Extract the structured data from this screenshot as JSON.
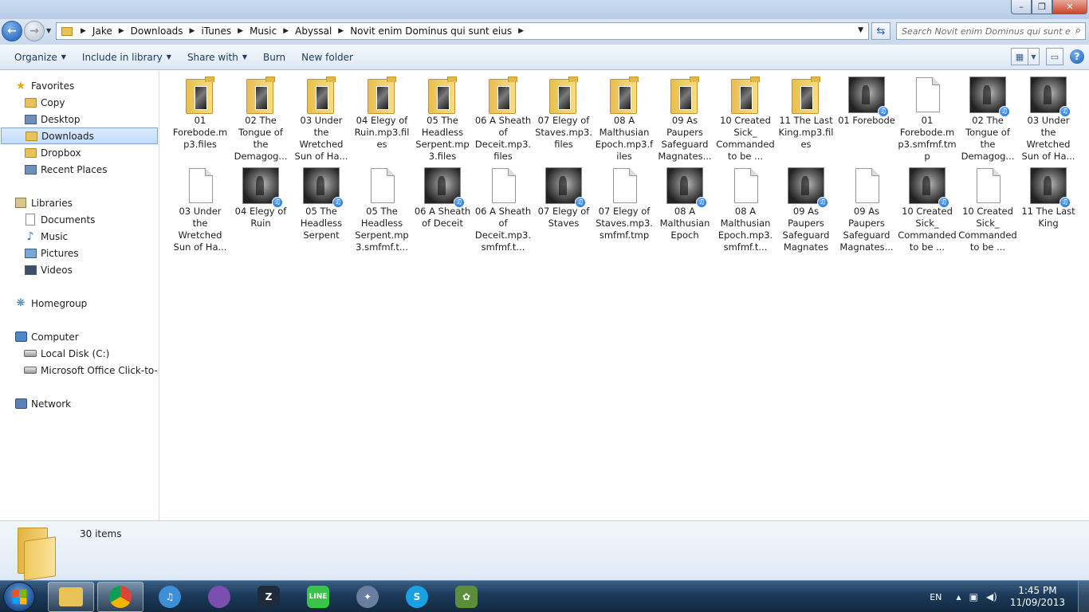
{
  "window": {
    "min_label": "–",
    "max_label": "❐",
    "close_label": "✕"
  },
  "address": {
    "breadcrumbs": [
      "Jake",
      "Downloads",
      "iTunes",
      "Music",
      "Abyssal",
      "Novit enim Dominus qui sunt eius"
    ]
  },
  "search": {
    "placeholder": "Search Novit enim Dominus qui sunt e..."
  },
  "toolbar": {
    "organize": "Organize",
    "include_in_library": "Include in library",
    "share_with": "Share with",
    "burn": "Burn",
    "new_folder": "New folder",
    "help": "?"
  },
  "sidebar": {
    "favorites": "Favorites",
    "fav_items": [
      "Copy",
      "Desktop",
      "Downloads",
      "Dropbox",
      "Recent Places"
    ],
    "libraries": "Libraries",
    "lib_items": [
      "Documents",
      "Music",
      "Pictures",
      "Videos"
    ],
    "homegroup": "Homegroup",
    "computer": "Computer",
    "comp_items": [
      "Local Disk (C:)",
      "Microsoft Office Click-to-Run"
    ],
    "network": "Network"
  },
  "files": [
    {
      "name": "01 Forebode.mp3.files",
      "type": "folder"
    },
    {
      "name": "02 The Tongue of the Demagog...",
      "type": "folder"
    },
    {
      "name": "03 Under the Wretched Sun of Ha...",
      "type": "folder"
    },
    {
      "name": "04 Elegy of Ruin.mp3.files",
      "type": "folder"
    },
    {
      "name": "05 The Headless Serpent.mp3.files",
      "type": "folder"
    },
    {
      "name": "06 A Sheath of Deceit.mp3.files",
      "type": "folder"
    },
    {
      "name": "07 Elegy of Staves.mp3.files",
      "type": "folder"
    },
    {
      "name": "08 A Malthusian Epoch.mp3.files",
      "type": "folder"
    },
    {
      "name": "09 As Paupers Safeguard Magnates...",
      "type": "folder"
    },
    {
      "name": "10 Created Sick_ Commanded to be ...",
      "type": "folder"
    },
    {
      "name": "11 The Last King.mp3.files",
      "type": "folder"
    },
    {
      "name": "01 Forebode",
      "type": "audio"
    },
    {
      "name": "01 Forebode.mp3.smfmf.tmp",
      "type": "file"
    },
    {
      "name": "02 The Tongue of the Demagog...",
      "type": "audio"
    },
    {
      "name": "03 Under the Wretched Sun of Ha...",
      "type": "audio"
    },
    {
      "name": "03 Under the Wretched Sun of Ha...",
      "type": "file"
    },
    {
      "name": "04 Elegy of Ruin",
      "type": "audio"
    },
    {
      "name": "05 The Headless Serpent",
      "type": "audio"
    },
    {
      "name": "05 The Headless Serpent.mp3.smfmf.t...",
      "type": "file"
    },
    {
      "name": "06 A Sheath of Deceit",
      "type": "audio"
    },
    {
      "name": "06 A Sheath of Deceit.mp3.smfmf.t...",
      "type": "file"
    },
    {
      "name": "07 Elegy of Staves",
      "type": "audio"
    },
    {
      "name": "07 Elegy of Staves.mp3.smfmf.tmp",
      "type": "file"
    },
    {
      "name": "08 A Malthusian Epoch",
      "type": "audio"
    },
    {
      "name": "08 A Malthusian Epoch.mp3.smfmf.t...",
      "type": "file"
    },
    {
      "name": "09 As Paupers Safeguard Magnates",
      "type": "audio"
    },
    {
      "name": "09 As Paupers Safeguard Magnates...",
      "type": "file"
    },
    {
      "name": "10 Created Sick_ Commanded to be ...",
      "type": "audio"
    },
    {
      "name": "10 Created Sick_ Commanded to be ...",
      "type": "file"
    },
    {
      "name": "11 The Last King",
      "type": "audio"
    }
  ],
  "details": {
    "count": "30 items"
  },
  "taskbar": {
    "apps": [
      {
        "name": "explorer",
        "label": "",
        "color": "#e9c25a"
      },
      {
        "name": "chrome",
        "label": "",
        "color": "#db4437"
      },
      {
        "name": "itunes",
        "label": "♫",
        "color": "#3f8fd8"
      },
      {
        "name": "bittorrent",
        "label": "",
        "color": "#7a4fb0"
      },
      {
        "name": "z-app",
        "label": "Z",
        "color": "#1f2b3d"
      },
      {
        "name": "line",
        "label": "LINE",
        "color": "#3ac34a"
      },
      {
        "name": "satellite",
        "label": "✦",
        "color": "#6a7fa0"
      },
      {
        "name": "skype",
        "label": "S",
        "color": "#1aa1e1"
      },
      {
        "name": "evernote",
        "label": "✿",
        "color": "#5c8d3a"
      }
    ],
    "lang": "EN",
    "tray_up": "▲",
    "tray_net": "▣",
    "tray_vol": "◀)",
    "time": "1:45 PM",
    "date": "11/09/2013"
  }
}
